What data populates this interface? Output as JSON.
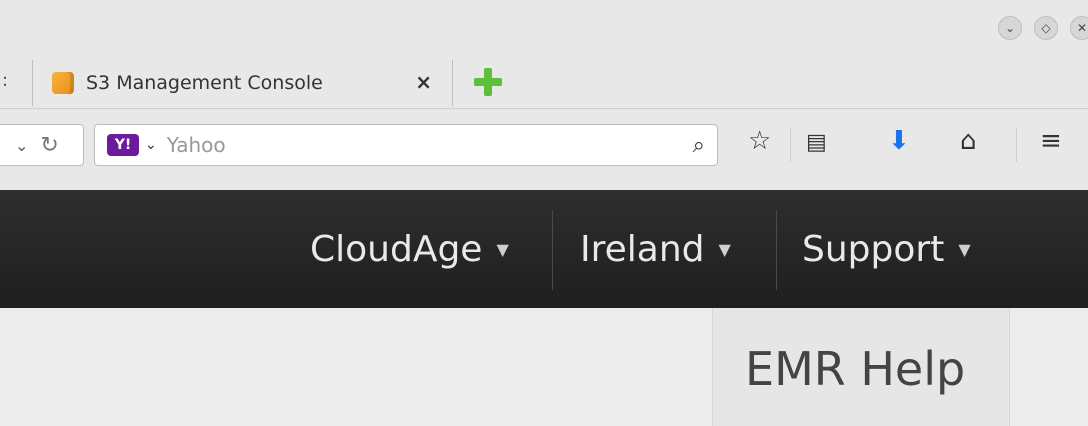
{
  "browser": {
    "tab": {
      "title": "S3 Management Console",
      "close_label": "×"
    },
    "prev_tab_fragment": ":",
    "search": {
      "engine_label": "Y!",
      "placeholder": "Yahoo"
    }
  },
  "aws_nav": {
    "items": [
      {
        "label": "CloudAge"
      },
      {
        "label": "Ireland"
      },
      {
        "label": "Support"
      }
    ]
  },
  "help": {
    "title": "EMR Help"
  },
  "colors": {
    "nav_bg": "#262626",
    "favicon": "#f2a93b",
    "new_tab_plus": "#5fbf3a",
    "download_arrow": "#1a73e8",
    "yahoo": "#6d1b9c"
  }
}
